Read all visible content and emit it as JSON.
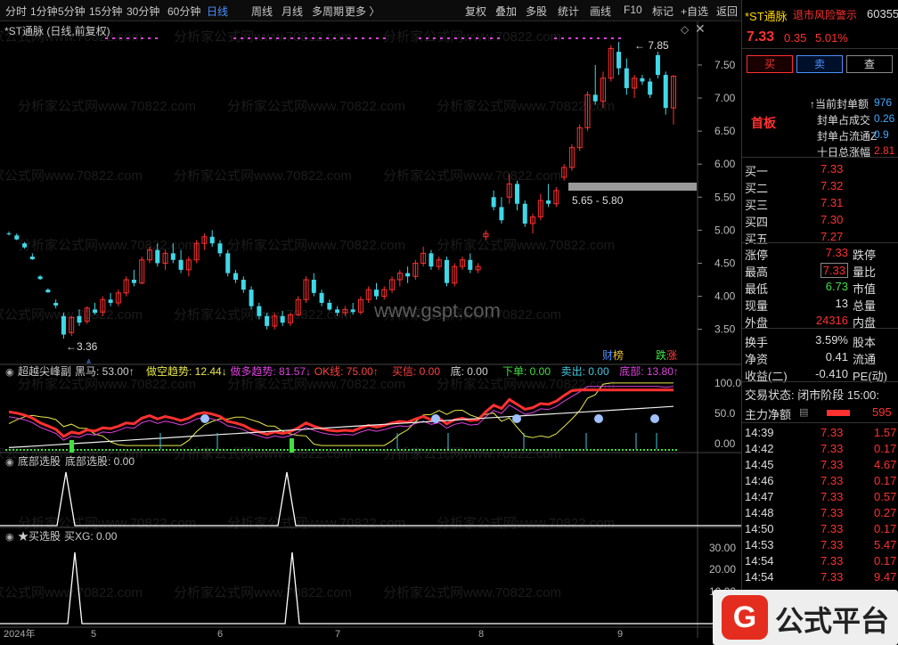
{
  "toolbar": {
    "periods": [
      "分时",
      "1分钟",
      "5分钟",
      "15分钟",
      "30分钟",
      "60分钟",
      "日线",
      "周线",
      "月线",
      "多周期",
      "更多 〉"
    ],
    "actions": [
      "复权",
      "叠加",
      "多股",
      "统计",
      "画线",
      "F10",
      "标记",
      "+自选",
      "返回"
    ]
  },
  "chart": {
    "title": "*ST通脉 (日线,前复权)",
    "high_label": "7.85",
    "low_label": "3.36",
    "range_label": "5.65 - 5.80",
    "badge_cw": "财",
    "badge_bang": "榜",
    "badge_die": "跌",
    "badge_zhang": "涨",
    "watermark": "www.gspt.com",
    "watermark_bg": "分析家公式网www.70822.com",
    "yaxis": [
      "7.50",
      "7.00",
      "6.50",
      "6.00",
      "5.50",
      "5.00",
      "4.50",
      "4.00",
      "3.50"
    ],
    "x_labels": [
      "2024年",
      "5",
      "6",
      "7",
      "8",
      "9"
    ],
    "candles": [
      [
        4.95,
        4.98,
        4.92,
        4.94
      ],
      [
        4.92,
        4.95,
        4.85,
        4.86
      ],
      [
        4.8,
        4.82,
        4.72,
        4.74
      ],
      [
        4.6,
        4.65,
        4.55,
        4.56
      ],
      [
        4.3,
        4.32,
        4.25,
        4.26
      ],
      [
        4.1,
        4.12,
        4.05,
        4.06
      ],
      [
        3.9,
        3.95,
        3.82,
        3.86
      ],
      [
        3.7,
        3.75,
        3.36,
        3.42
      ],
      [
        3.45,
        3.7,
        3.4,
        3.68
      ],
      [
        3.7,
        3.8,
        3.55,
        3.6
      ],
      [
        3.62,
        3.85,
        3.58,
        3.82
      ],
      [
        3.8,
        3.9,
        3.72,
        3.75
      ],
      [
        3.76,
        4.0,
        3.7,
        3.95
      ],
      [
        3.95,
        4.05,
        3.85,
        3.9
      ],
      [
        3.9,
        4.1,
        3.85,
        4.05
      ],
      [
        4.05,
        4.3,
        4.0,
        4.25
      ],
      [
        4.25,
        4.4,
        4.15,
        4.2
      ],
      [
        4.2,
        4.6,
        4.18,
        4.55
      ],
      [
        4.55,
        4.75,
        4.5,
        4.7
      ],
      [
        4.7,
        4.8,
        4.45,
        4.5
      ],
      [
        4.5,
        4.7,
        4.4,
        4.65
      ],
      [
        4.65,
        4.8,
        4.5,
        4.55
      ],
      [
        4.55,
        4.7,
        4.35,
        4.4
      ],
      [
        4.4,
        4.6,
        4.3,
        4.55
      ],
      [
        4.55,
        4.85,
        4.5,
        4.8
      ],
      [
        4.8,
        4.95,
        4.7,
        4.9
      ],
      [
        4.9,
        5.0,
        4.75,
        4.8
      ],
      [
        4.8,
        4.85,
        4.6,
        4.65
      ],
      [
        4.65,
        4.7,
        4.3,
        4.35
      ],
      [
        4.35,
        4.4,
        4.2,
        4.25
      ],
      [
        4.25,
        4.3,
        4.05,
        4.1
      ],
      [
        4.1,
        4.15,
        3.8,
        3.85
      ],
      [
        3.85,
        3.9,
        3.65,
        3.7
      ],
      [
        3.7,
        3.75,
        3.5,
        3.55
      ],
      [
        3.55,
        3.75,
        3.5,
        3.7
      ],
      [
        3.7,
        3.78,
        3.55,
        3.6
      ],
      [
        3.6,
        3.75,
        3.55,
        3.72
      ],
      [
        3.72,
        4.0,
        3.7,
        3.95
      ],
      [
        3.95,
        4.3,
        3.9,
        4.25
      ],
      [
        4.25,
        4.35,
        4.0,
        4.05
      ],
      [
        4.05,
        4.1,
        3.85,
        3.9
      ],
      [
        3.9,
        3.95,
        3.78,
        3.8
      ],
      [
        3.8,
        3.85,
        3.7,
        3.75
      ],
      [
        3.75,
        3.85,
        3.7,
        3.8
      ],
      [
        3.8,
        3.9,
        3.72,
        3.76
      ],
      [
        3.76,
        4.0,
        3.72,
        3.95
      ],
      [
        3.95,
        4.15,
        3.9,
        4.1
      ],
      [
        4.1,
        4.2,
        3.95,
        4.0
      ],
      [
        4.0,
        4.15,
        3.95,
        4.1
      ],
      [
        4.1,
        4.3,
        4.05,
        4.25
      ],
      [
        4.25,
        4.4,
        4.15,
        4.35
      ],
      [
        4.35,
        4.45,
        4.2,
        4.3
      ],
      [
        4.3,
        4.55,
        4.25,
        4.5
      ],
      [
        4.5,
        4.75,
        4.45,
        4.65
      ],
      [
        4.65,
        4.7,
        4.4,
        4.45
      ],
      [
        4.45,
        4.6,
        4.4,
        4.55
      ],
      [
        4.55,
        4.6,
        4.15,
        4.2
      ],
      [
        4.2,
        4.5,
        4.15,
        4.45
      ],
      [
        4.45,
        4.6,
        4.4,
        4.55
      ],
      [
        4.55,
        4.65,
        4.35,
        4.4
      ],
      [
        4.4,
        4.5,
        4.35,
        4.45
      ],
      [
        4.9,
        5.0,
        4.85,
        4.95
      ],
      [
        5.5,
        5.6,
        5.3,
        5.35
      ],
      [
        5.35,
        5.5,
        5.1,
        5.15
      ],
      [
        5.5,
        5.85,
        5.4,
        5.7
      ],
      [
        5.7,
        5.75,
        5.3,
        5.4
      ],
      [
        5.4,
        5.45,
        5.05,
        5.1
      ],
      [
        5.1,
        5.25,
        4.95,
        5.2
      ],
      [
        5.2,
        5.55,
        5.15,
        5.45
      ],
      [
        5.45,
        5.7,
        5.35,
        5.4
      ],
      [
        5.4,
        5.65,
        5.35,
        5.6
      ],
      [
        5.8,
        6.0,
        5.75,
        5.95
      ],
      [
        5.95,
        6.3,
        5.9,
        6.25
      ],
      [
        6.25,
        6.6,
        6.2,
        6.55
      ],
      [
        6.55,
        7.1,
        6.5,
        7.05
      ],
      [
        7.05,
        7.5,
        6.9,
        6.95
      ],
      [
        6.95,
        7.4,
        6.85,
        7.3
      ],
      [
        7.3,
        7.8,
        7.25,
        7.75
      ],
      [
        7.7,
        7.85,
        7.35,
        7.45
      ],
      [
        7.45,
        7.6,
        7.05,
        7.15
      ],
      [
        7.15,
        7.35,
        7.0,
        7.3
      ],
      [
        7.3,
        7.35,
        7.2,
        7.25
      ],
      [
        7.25,
        7.3,
        7.0,
        7.05
      ],
      [
        7.65,
        7.7,
        7.3,
        7.35
      ],
      [
        7.35,
        7.4,
        6.75,
        6.85
      ],
      [
        6.85,
        7.35,
        6.6,
        7.33
      ]
    ],
    "ohlc_note": ""
  },
  "ind1": {
    "name": "超越尖峰副",
    "items": [
      {
        "l": "黑马: 53.00↑",
        "c": "#d0d0d0"
      },
      {
        "l": "做空趋势: 12.44↓",
        "c": "#e8e84a"
      },
      {
        "l": "做多趋势: 81.57↓",
        "c": "#e040e0"
      },
      {
        "l": "OK线: 75.00↑",
        "c": "#ff4040"
      },
      {
        "l": "买信: 0.00",
        "c": "#ff4040"
      },
      {
        "l": "底: 0.00",
        "c": "#d0d0d0"
      },
      {
        "l": "下单: 0.00",
        "c": "#40e040"
      },
      {
        "l": "卖出: 0.00",
        "c": "#40c8e0"
      },
      {
        "l": "底部: 13.80↑",
        "c": "#e040e0"
      }
    ],
    "yaxis": [
      "100.0",
      "50.0",
      "0.00"
    ]
  },
  "ind2": {
    "name": "底部选股",
    "value": "底部选股: 0.00"
  },
  "ind3": {
    "name": "★买选股",
    "value": "买XG: 0.00",
    "yaxis": [
      "30.00",
      "20.00",
      "10.00"
    ]
  },
  "quote": {
    "name": "*ST通脉",
    "tag": "退市风险警示",
    "code": "60355",
    "price": "7.33",
    "change": "0.35",
    "pct": "5.01%",
    "buy": "买",
    "sell": "卖",
    "view": "查",
    "board": "首板",
    "stats": [
      {
        "k": "当前封单额",
        "v": "976"
      },
      {
        "k": "封单占成交",
        "v": "0.26"
      },
      {
        "k": "封单占流通Z",
        "v": "0.9"
      },
      {
        "k": "十日总涨幅",
        "v": "2.81"
      }
    ],
    "bids": [
      {
        "k": "买一",
        "p": "7.33"
      },
      {
        "k": "买二",
        "p": "7.32"
      },
      {
        "k": "买三",
        "p": "7.31"
      },
      {
        "k": "买四",
        "p": "7.30"
      },
      {
        "k": "买五",
        "p": "7.27"
      }
    ],
    "info": [
      {
        "k": "涨停",
        "v": "7.33",
        "c": "#ff3030",
        "k2": "跌停"
      },
      {
        "k": "最高",
        "v": "7.33",
        "c": "#ff3030",
        "k2": "量比"
      },
      {
        "k": "最低",
        "v": "6.73",
        "c": "#40e040",
        "k2": "市值"
      },
      {
        "k": "现量",
        "v": "13",
        "c": "#ddd",
        "k2": "总量"
      },
      {
        "k": "外盘",
        "v": "24316",
        "c": "#ff3030",
        "k2": "内盘"
      }
    ],
    "info2": [
      {
        "k": "换手",
        "v": "3.59%",
        "k2": "股本"
      },
      {
        "k": "净资",
        "v": "0.41",
        "k2": "流通"
      },
      {
        "k": "收益(二)",
        "v": "-0.410",
        "k2": "PE(动)"
      }
    ],
    "status": "交易状态: 闭市阶段 15:00:",
    "netflow_label": "主力净额",
    "netflow_value": "595",
    "ticks": [
      {
        "t": "14:39",
        "p": "7.33",
        "v": "1.57"
      },
      {
        "t": "14:42",
        "p": "7.33",
        "v": "0.17"
      },
      {
        "t": "14:45",
        "p": "7.33",
        "v": "4.67"
      },
      {
        "t": "14:46",
        "p": "7.33",
        "v": "0.17"
      },
      {
        "t": "14:47",
        "p": "7.33",
        "v": "0.57"
      },
      {
        "t": "14:48",
        "p": "7.33",
        "v": "0.27"
      },
      {
        "t": "14:50",
        "p": "7.33",
        "v": "0.17"
      },
      {
        "t": "14:53",
        "p": "7.33",
        "v": "5.47"
      },
      {
        "t": "14:54",
        "p": "7.33",
        "v": "0.17"
      },
      {
        "t": "14:54",
        "p": "7.33",
        "v": "9.47"
      }
    ]
  },
  "logo": {
    "text": "公式平台",
    "icon": "G"
  }
}
